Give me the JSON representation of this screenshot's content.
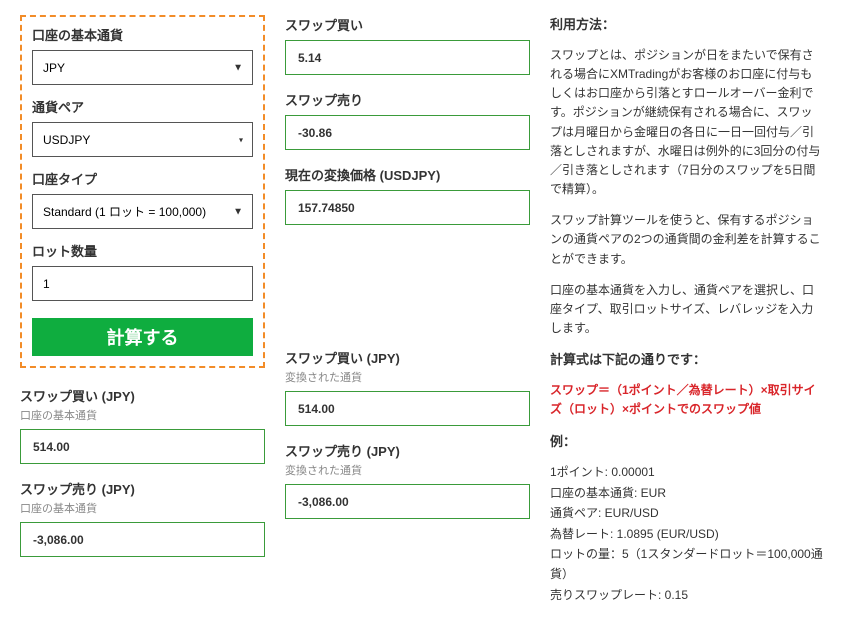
{
  "form": {
    "base_currency_label": "口座の基本通貨",
    "base_currency_value": "JPY",
    "currency_pair_label": "通貨ペア",
    "currency_pair_value": "USDJPY",
    "account_type_label": "口座タイプ",
    "account_type_value": "Standard (1 ロット = 100,000)",
    "lot_size_label": "ロット数量",
    "lot_size_value": "1",
    "calculate_button": "計算する"
  },
  "results": {
    "swap_buy_label": "スワップ買い",
    "swap_buy_value": "5.14",
    "swap_sell_label": "スワップ売り",
    "swap_sell_value": "-30.86",
    "conversion_price_label": "現在の変換価格 (USDJPY)",
    "conversion_price_value": "157.74850"
  },
  "bottom_left": {
    "swap_buy_header": "スワップ買い (JPY)",
    "swap_buy_sub": "口座の基本通貨",
    "swap_buy_value": "514.00",
    "swap_sell_header": "スワップ売り (JPY)",
    "swap_sell_sub": "口座の基本通貨",
    "swap_sell_value": "-3,086.00"
  },
  "bottom_mid": {
    "swap_buy_header": "スワップ買い (JPY)",
    "swap_buy_sub": "変換された通貨",
    "swap_buy_value": "514.00",
    "swap_sell_header": "スワップ売り (JPY)",
    "swap_sell_sub": "変換された通貨",
    "swap_sell_value": "-3,086.00"
  },
  "info": {
    "heading1": "利用方法：",
    "para1": "スワップとは、ポジションが日をまたいで保有される場合にXMTradingがお客様のお口座に付与もしくはお口座から引落とすロールオーバー金利です。ポジションが継続保有される場合に、スワップは月曜日から金曜日の各日に一日一回付与／引落としされますが、水曜日は例外的に3回分の付与／引き落としされます（7日分のスワップを5日間で精算）。",
    "para2": "スワップ計算ツールを使うと、保有するポジションの通貨ペアの2つの通貨間の金利差を計算することができます。",
    "para3": "口座の基本通貨を入力し、通貨ペアを選択し、口座タイプ、取引ロットサイズ、レバレッジを入力します。",
    "heading2": "計算式は下記の通りです：",
    "formula": "スワップ＝（1ポイント／為替レート）×取引サイズ（ロット）×ポイントでのスワップ値",
    "example_heading": "例：",
    "example_lines": [
      "1ポイント: 0.00001",
      "口座の基本通貨: EUR",
      "通貨ペア: EUR/USD",
      "為替レート: 1.0895 (EUR/USD)",
      "ロットの量：5（1スタンダードロット＝100,000通貨）",
      "売りスワップレート: 0.15"
    ]
  }
}
